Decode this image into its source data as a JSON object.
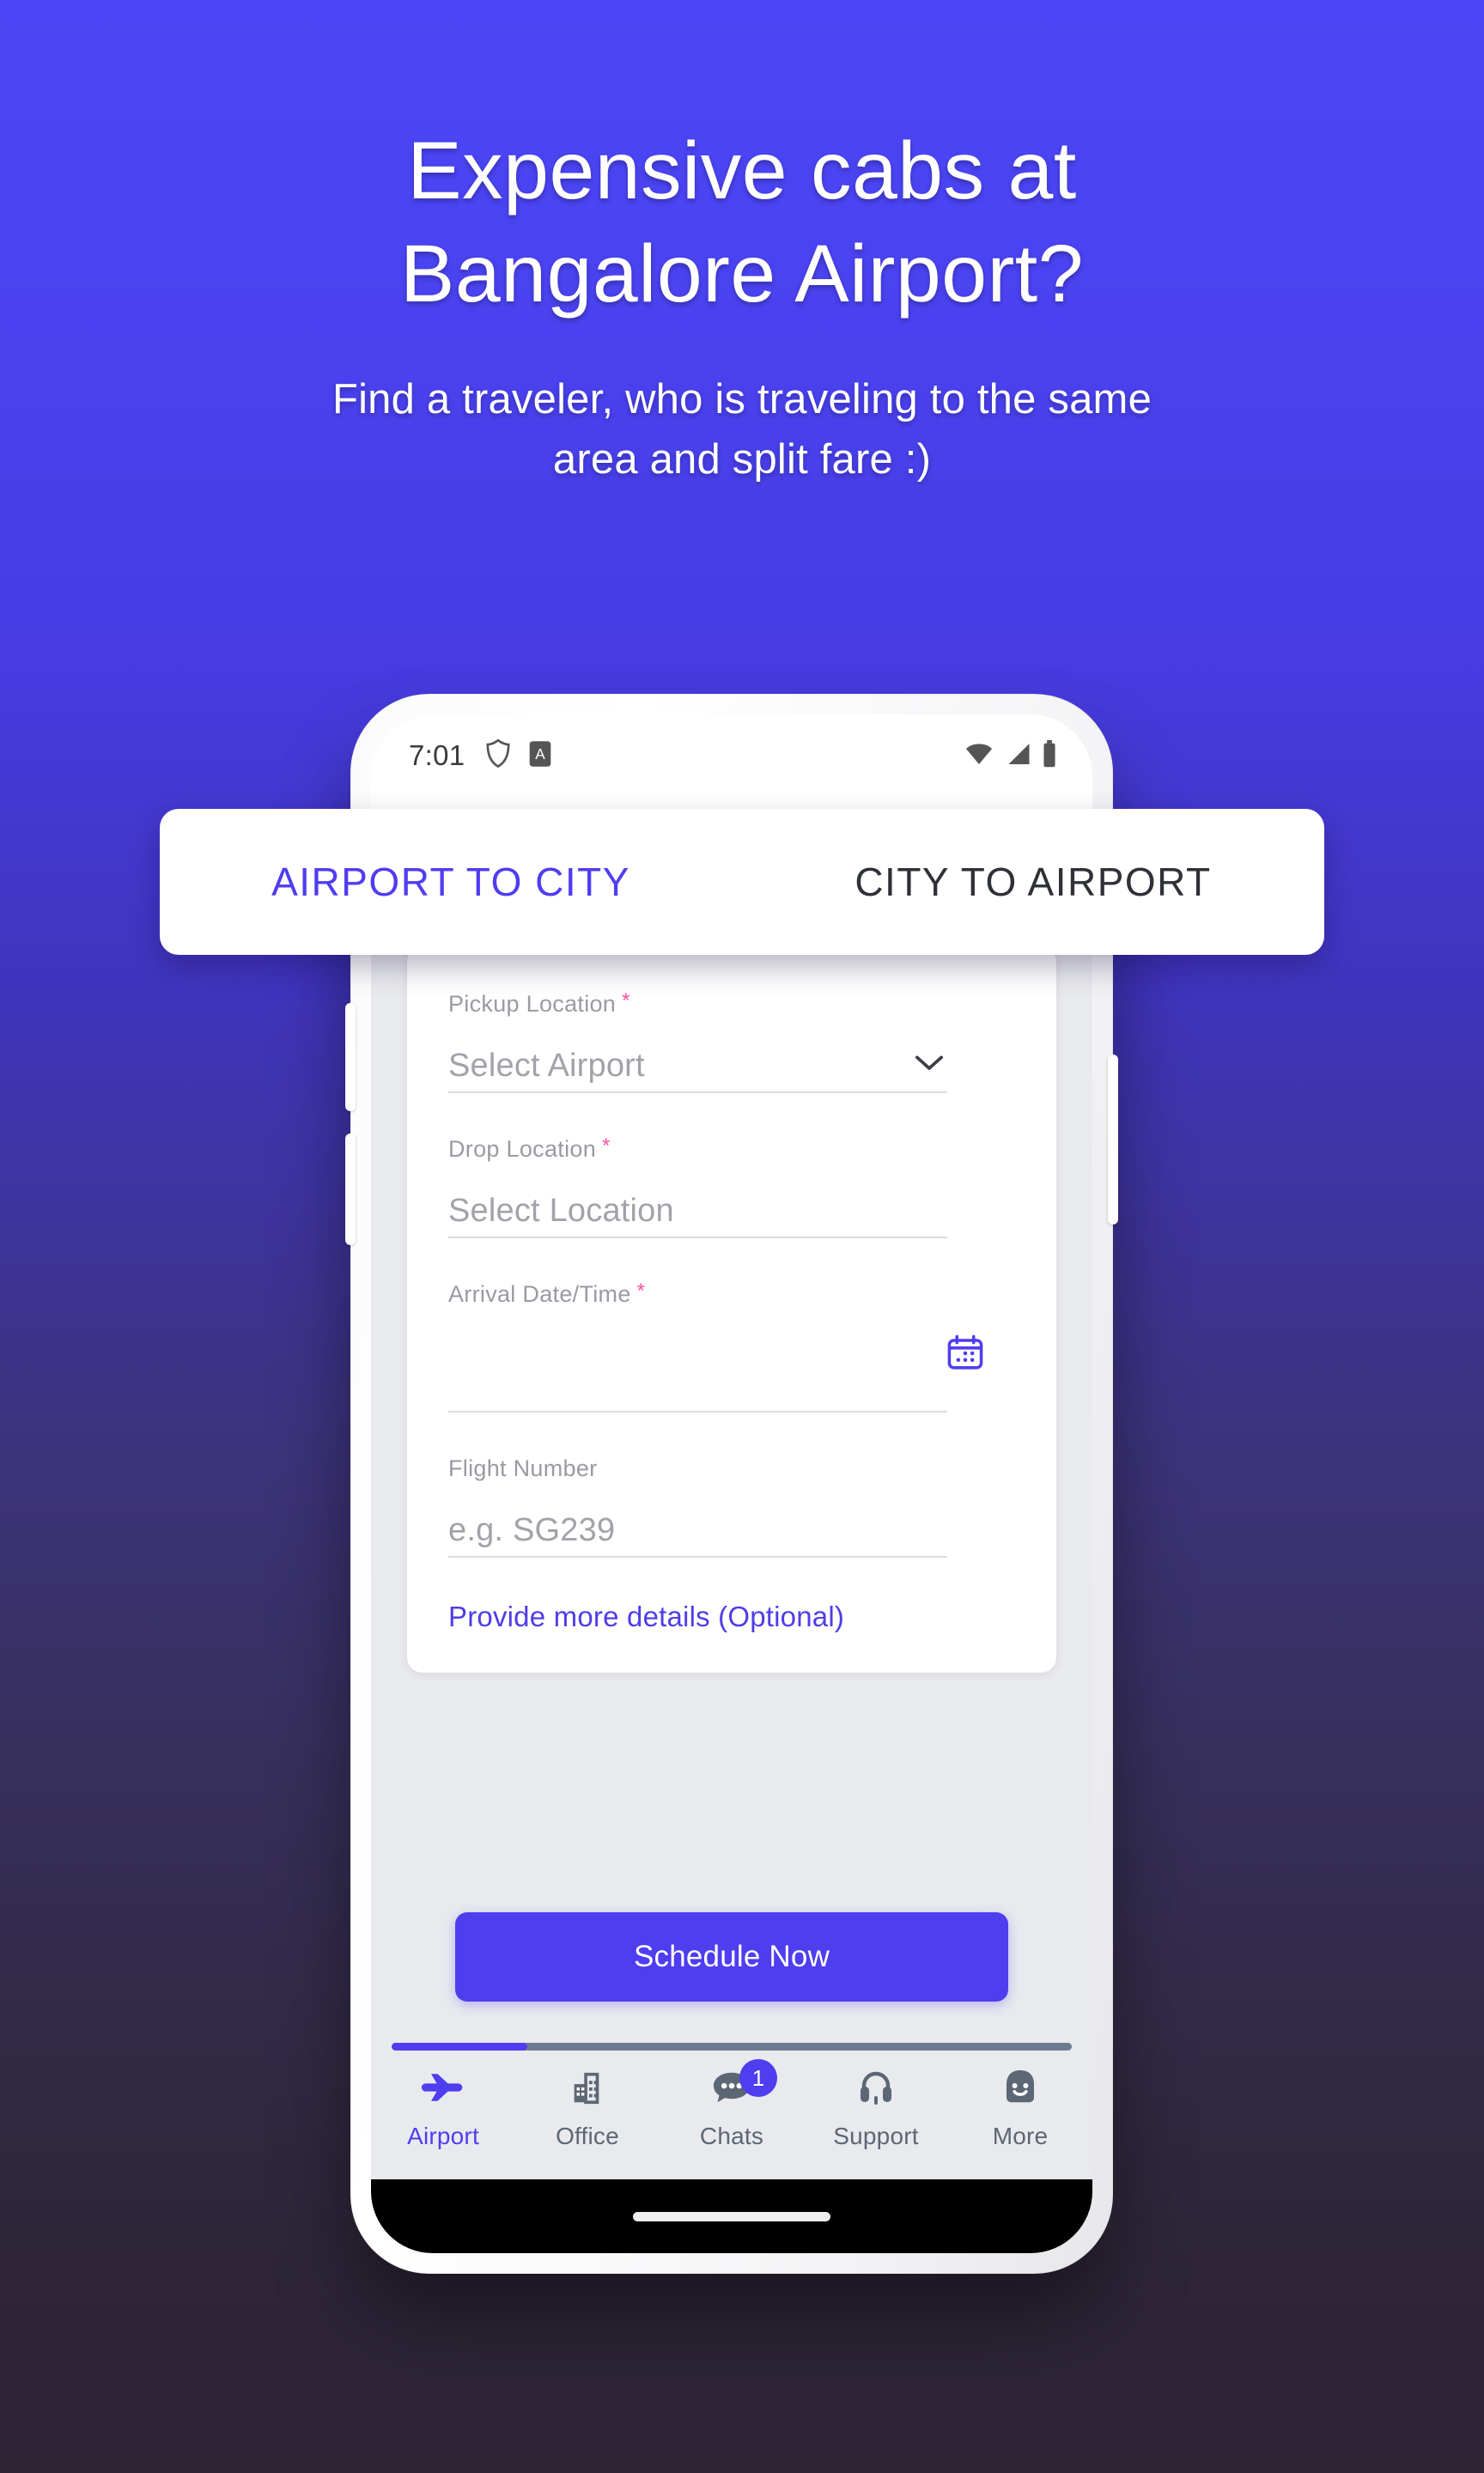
{
  "hero": {
    "title_line1": "Expensive cabs at",
    "title_line2": "Bangalore Airport?",
    "subtitle_line1": "Find a traveler, who is traveling to the same",
    "subtitle_line2": "area and split fare :)"
  },
  "colors": {
    "accent": "#4f3df0",
    "bg_top": "#4b46f7",
    "bg_mid": "#3d337d",
    "bg_bottom": "#2c2433",
    "required_star": "#ff4fa3",
    "screen_bg": "#e9eaee"
  },
  "status_bar": {
    "time": "7:01",
    "icons": [
      "shield-icon",
      "letter-a-badge-icon",
      "wifi-icon",
      "signal-icon",
      "battery-icon"
    ]
  },
  "tabs": [
    {
      "label": "AIRPORT TO CITY",
      "active": true
    },
    {
      "label": "CITY TO AIRPORT",
      "active": false
    }
  ],
  "form": {
    "fields": [
      {
        "label": "Pickup Location",
        "required": "*",
        "placeholder": "Select Airport",
        "control": "dropdown"
      },
      {
        "label": "Drop Location",
        "required": "*",
        "placeholder": "Select Location",
        "control": "text"
      },
      {
        "label": "Arrival Date/Time",
        "required": "*",
        "placeholder": "",
        "control": "date"
      },
      {
        "label": "Flight Number",
        "required": "",
        "placeholder": "e.g. SG239",
        "control": "text"
      }
    ],
    "more_details_link": "Provide more details (Optional)"
  },
  "cta": {
    "label": "Schedule Now"
  },
  "bottom_nav": {
    "items": [
      {
        "label": "Airport",
        "icon": "airplane-icon",
        "active": true,
        "badge": ""
      },
      {
        "label": "Office",
        "icon": "building-icon",
        "active": false,
        "badge": ""
      },
      {
        "label": "Chats",
        "icon": "chat-bubble-icon",
        "active": false,
        "badge": "1"
      },
      {
        "label": "Support",
        "icon": "headset-icon",
        "active": false,
        "badge": ""
      },
      {
        "label": "More",
        "icon": "smiley-icon",
        "active": false,
        "badge": ""
      }
    ]
  }
}
